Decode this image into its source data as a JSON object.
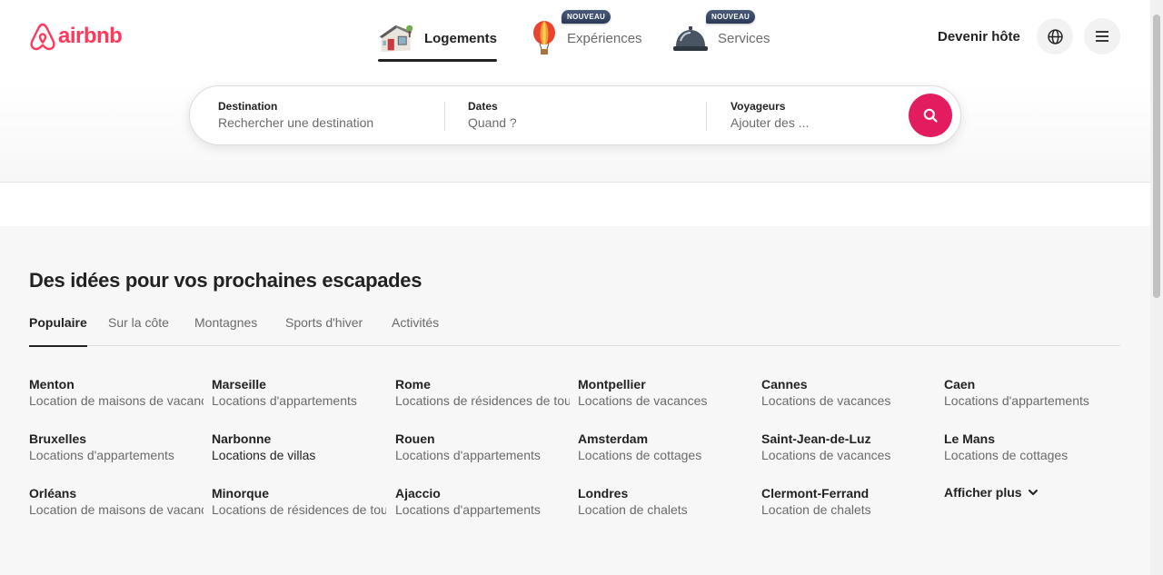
{
  "brand": {
    "name": "airbnb",
    "color": "#ff385c"
  },
  "nav": {
    "tabs": [
      {
        "label": "Logements",
        "icon": "house-icon",
        "active": true
      },
      {
        "label": "Expériences",
        "icon": "hot-air-balloon-icon",
        "badge": "NOUVEAU"
      },
      {
        "label": "Services",
        "icon": "service-bell-icon",
        "badge": "NOUVEAU"
      }
    ],
    "host_label": "Devenir hôte",
    "globe_icon": "globe-icon",
    "menu_icon": "hamburger-menu-icon"
  },
  "search": {
    "destination": {
      "label": "Destination",
      "placeholder": "Rechercher une destination"
    },
    "dates": {
      "label": "Dates",
      "placeholder": "Quand ?"
    },
    "guests": {
      "label": "Voyageurs",
      "placeholder": "Ajouter des ..."
    },
    "button_icon": "search-icon",
    "button_color": "#e31c5f"
  },
  "inspiration": {
    "title": "Des idées pour vos prochaines escapades",
    "tabs": [
      "Populaire",
      "Sur la côte",
      "Montagnes",
      "Sports d'hiver",
      "Activités"
    ],
    "active_tab": "Populaire",
    "destinations": [
      {
        "city": "Menton",
        "desc": "Location de maisons de vacances"
      },
      {
        "city": "Marseille",
        "desc": "Locations d'appartements"
      },
      {
        "city": "Rome",
        "desc": "Locations de résidences de tourisme"
      },
      {
        "city": "Montpellier",
        "desc": "Locations de vacances"
      },
      {
        "city": "Cannes",
        "desc": "Locations de vacances"
      },
      {
        "city": "Caen",
        "desc": "Locations d'appartements"
      },
      {
        "city": "Bruxelles",
        "desc": "Locations d'appartements"
      },
      {
        "city": "Narbonne",
        "desc": "Locations de villas"
      },
      {
        "city": "Rouen",
        "desc": "Locations d'appartements"
      },
      {
        "city": "Amsterdam",
        "desc": "Locations de cottages"
      },
      {
        "city": "Saint-Jean-de-Luz",
        "desc": "Locations de vacances"
      },
      {
        "city": "Le Mans",
        "desc": "Locations de cottages"
      },
      {
        "city": "Orléans",
        "desc": "Location de maisons de vacances"
      },
      {
        "city": "Minorque",
        "desc": "Locations de résidences de tourisme"
      },
      {
        "city": "Ajaccio",
        "desc": "Locations d'appartements"
      },
      {
        "city": "Londres",
        "desc": "Location de chalets"
      },
      {
        "city": "Clermont-Ferrand",
        "desc": "Location de chalets"
      }
    ],
    "show_more": "Afficher plus",
    "show_more_icon": "chevron-down-icon"
  }
}
